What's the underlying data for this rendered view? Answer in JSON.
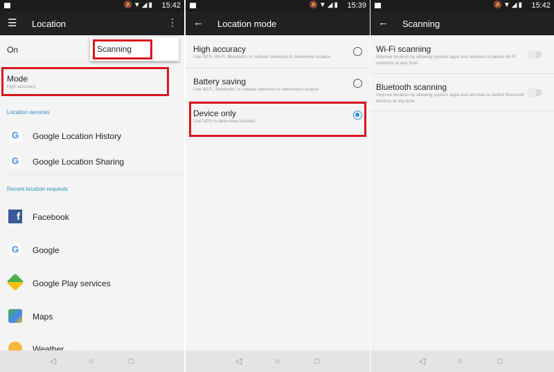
{
  "status_bar": [
    {
      "time": "15:42"
    },
    {
      "time": "15:39"
    },
    {
      "time": "15:42"
    }
  ],
  "location": {
    "title": "Location",
    "on_label": "On",
    "menu_item": "Scanning",
    "mode_title": "Mode",
    "mode_value": "High accuracy",
    "services_header": "Location services",
    "services": [
      "Google Location History",
      "Google Location Sharing"
    ],
    "recent_header": "Recent location requests",
    "recent": [
      "Facebook",
      "Google",
      "Google Play services",
      "Maps",
      "Weather"
    ]
  },
  "location_mode": {
    "title": "Location mode",
    "options": [
      {
        "title": "High accuracy",
        "desc": "Use GPS, Wi-Fi, Bluetooth, or cellular networks to determine location",
        "selected": false
      },
      {
        "title": "Battery saving",
        "desc": "Use Wi-Fi, Bluetooth, or cellular networks to determine location",
        "selected": false
      },
      {
        "title": "Device only",
        "desc": "Use GPS to determine location",
        "selected": true
      }
    ]
  },
  "scanning": {
    "title": "Scanning",
    "items": [
      {
        "title": "Wi-Fi scanning",
        "desc": "Improve location by allowing system apps and services to detect Wi-Fi networks at any time.",
        "enabled": false
      },
      {
        "title": "Bluetooth scanning",
        "desc": "Improve location by allowing system apps and services to detect Bluetooth devices at any time.",
        "enabled": false
      }
    ]
  },
  "colors": {
    "highlight": "#d9141e",
    "accent": "#2a8fd6"
  }
}
